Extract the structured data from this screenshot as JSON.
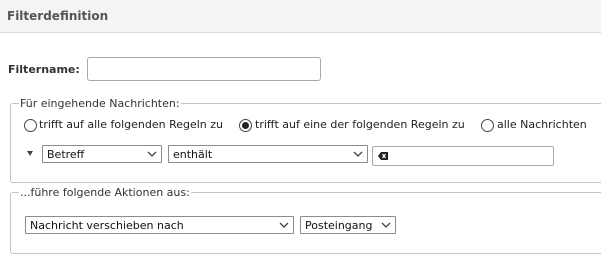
{
  "header": {
    "title": "Filterdefinition"
  },
  "filter_name": {
    "label": "Filtername:",
    "value": ""
  },
  "incoming": {
    "legend": "Für eingehende Nachrichten:",
    "options": [
      {
        "label": "trifft auf alle folgenden Regeln zu",
        "checked": false
      },
      {
        "label": "trifft auf eine der folgenden Regeln zu",
        "checked": true
      },
      {
        "label": "alle Nachrichten",
        "checked": false
      }
    ],
    "rule": {
      "field": "Betreff",
      "operator": "enthält",
      "value": ""
    }
  },
  "actions": {
    "legend": "...führe folgende Aktionen aus:",
    "action": "Nachricht verschieben nach",
    "target": "Posteingang"
  }
}
